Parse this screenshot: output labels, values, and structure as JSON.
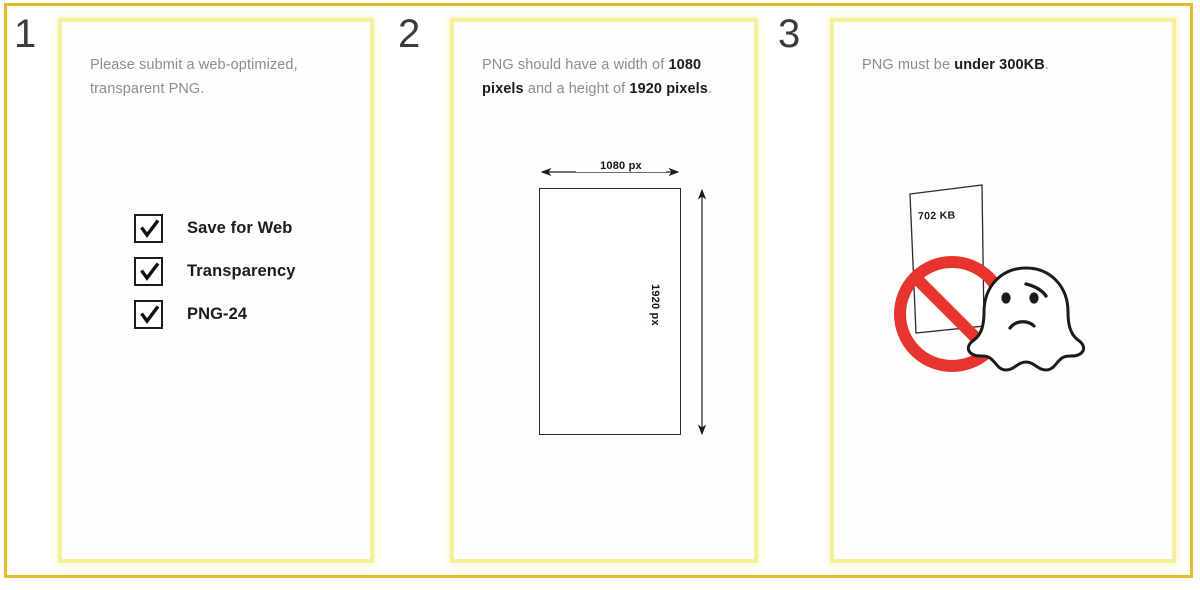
{
  "frame": {
    "border_color": "#e2bb2e",
    "card_border_color": "#f6f09c",
    "background": "#ffffff"
  },
  "steps": [
    {
      "number": "1",
      "text_plain": "Please submit a web-optimized, transparent PNG.",
      "text_html": "Please submit a web-optimized, transparent PNG.",
      "checklist": [
        {
          "label": "Save for Web",
          "checked": true
        },
        {
          "label": "Transparency",
          "checked": true
        },
        {
          "label": "PNG-24",
          "checked": true
        }
      ],
      "watermark": ""
    },
    {
      "number": "2",
      "text_plain": "PNG should have a width of 1080 pixels and a height of 1920 pixels.",
      "text_html": "PNG should have a width of <b>1080 pixels</b> and a height of <b>1920 pixels</b>.",
      "diagram": {
        "width_label": "1080 px",
        "height_label": "1920 px",
        "shape": "rectangle",
        "aspect_ratio": "1080:1920"
      }
    },
    {
      "number": "3",
      "text_plain": "PNG must be under 300KB.",
      "text_html": "PNG must be <b>under 300KB</b>.",
      "artwork": {
        "file_size_label": "702 KB",
        "prohibition_sign": "no-entry-icon",
        "prohibition_color": "#e8342e",
        "mascot": "angry-ghost-icon"
      }
    }
  ]
}
